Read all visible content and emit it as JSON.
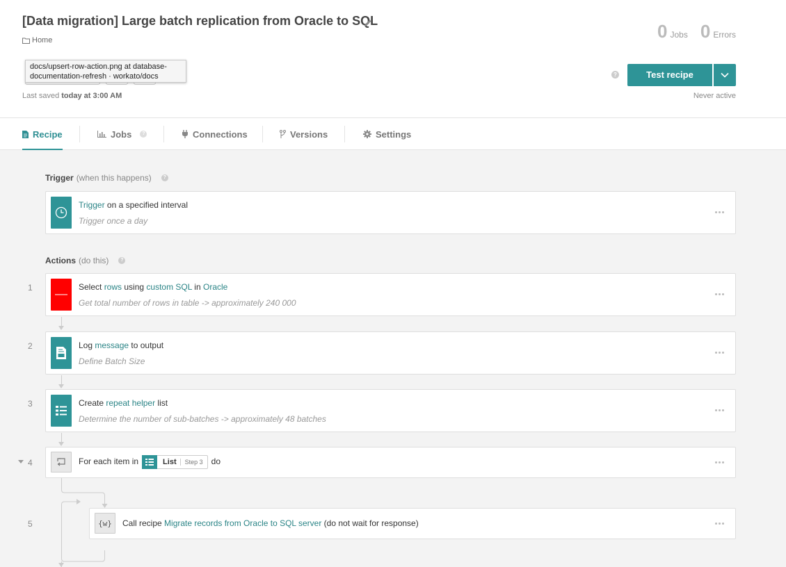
{
  "header": {
    "title": "[Data migration] Large batch replication from Oracle to SQL",
    "breadcrumb": "Home",
    "tooltip_line1": "docs/upsert-row-action.png at database-",
    "tooltip_line2": "documentation-refresh · workato/docs",
    "last_saved_prefix": "Last saved",
    "last_saved_time": "today at 3:00 AM",
    "jobs_count": "0",
    "jobs_label": "Jobs",
    "errors_count": "0",
    "errors_label": "Errors",
    "help": "?",
    "test_button": "Test recipe",
    "status": "Never active"
  },
  "tabs": [
    {
      "label": "Recipe",
      "icon": "document-icon"
    },
    {
      "label": "Jobs",
      "icon": "bar-chart-icon",
      "help": "?"
    },
    {
      "label": "Connections",
      "icon": "plug-icon"
    },
    {
      "label": "Versions",
      "icon": "branch-icon"
    },
    {
      "label": "Settings",
      "icon": "gear-icon"
    }
  ],
  "trigger_section": {
    "label": "Trigger",
    "sub": "(when this happens)",
    "help": "?"
  },
  "actions_section": {
    "label": "Actions",
    "sub": "(do this)",
    "help": "?"
  },
  "trigger_step": {
    "link": "Trigger",
    "text": " on a specified interval",
    "description": "Trigger once a day"
  },
  "steps": [
    {
      "number": "1",
      "t1": "Select ",
      "l1": "rows",
      "t2": " using ",
      "l2": "custom SQL",
      "t3": " in ",
      "l3": "Oracle",
      "description": "Get total number of rows in table -> approximately 240 000"
    },
    {
      "number": "2",
      "t1": "Log ",
      "l1": "message",
      "t2": " to output",
      "description": "Define Batch Size"
    },
    {
      "number": "3",
      "t1": "Create ",
      "l1": "repeat helper",
      "t2": " list",
      "description": "Determine the number of sub-batches -> approximately 48 batches"
    },
    {
      "number": "4",
      "t1": "For each item in",
      "pill_label": "List",
      "pill_step": "Step 3",
      "t2": "do"
    },
    {
      "number": "5",
      "t1": "Call recipe ",
      "l1": "Migrate records from Oracle to SQL server",
      "t2": " (do not wait for response)",
      "icon_text": "{w}"
    }
  ],
  "colors": {
    "accent": "#2e9497",
    "oracle": "#ff0000",
    "link": "#2a8486"
  }
}
